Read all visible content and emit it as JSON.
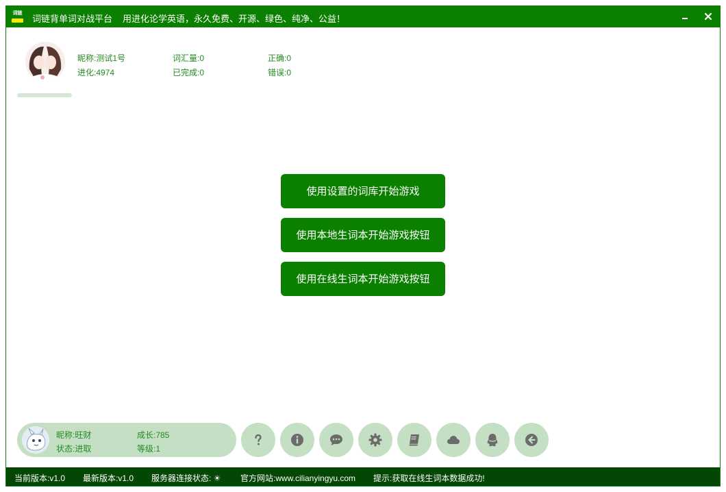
{
  "app": {
    "logo_text": "词链",
    "title": "词链背单词对战平台",
    "slogan": "用进化论学英语，永久免费、开源、绿色、纯净、公益！",
    "close_symbol": "×"
  },
  "profile": {
    "nickname": "昵称:测试1号",
    "evolution": "进化:4974",
    "vocabulary": "词汇量:0",
    "completed": "已完成:0",
    "correct": "正确:0",
    "wrong": "错误:0",
    "progress": 0
  },
  "actions": {
    "start_setting": "使用设置的词库开始游戏",
    "start_local": "使用本地生词本开始游戏按钮",
    "start_online": "使用在线生词本开始游戏按钮"
  },
  "pet": {
    "nickname": "昵称:旺财",
    "status": "状态:进取",
    "growth": "成长:785",
    "level": "等级:1"
  },
  "toolbar": {
    "icons": [
      "question-icon",
      "info-icon",
      "chat-icon",
      "gear-icon",
      "book-icon",
      "cloud-icon",
      "qq-icon",
      "back-arrow-icon"
    ]
  },
  "statusbar": {
    "current_version": "当前版本:v1.0",
    "latest_version": "最新版本:v1.0",
    "server_status": "服务器连接状态: ☀",
    "website": "官方网站:www.cilianyingyu.com",
    "tip": "提示:获取在线生词本数据成功!"
  },
  "colors": {
    "primary": "#0a7f00",
    "statusbar": "#044604",
    "soft": "#c4dfc4",
    "info_text": "#238a23"
  }
}
